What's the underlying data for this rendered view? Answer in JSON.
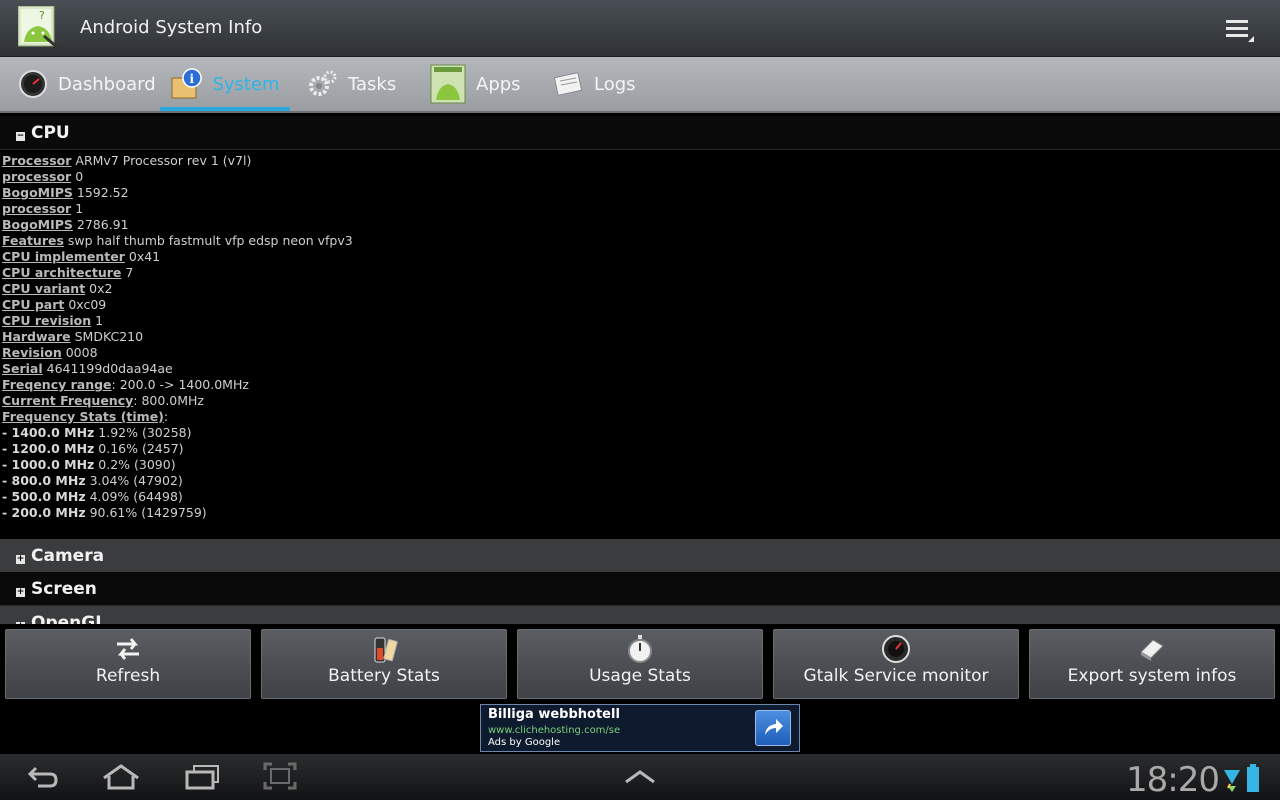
{
  "app": {
    "title": "Android System Info",
    "icon": "android-app-icon",
    "menu_icon": "overflow-menu-icon"
  },
  "tabs": [
    {
      "label": "Dashboard",
      "icon": "dashboard-gauge-icon",
      "active": false
    },
    {
      "label": "System",
      "icon": "system-info-icon",
      "active": true
    },
    {
      "label": "Tasks",
      "icon": "gears-icon",
      "active": false
    },
    {
      "label": "Apps",
      "icon": "android-apps-icon",
      "active": false
    },
    {
      "label": "Logs",
      "icon": "logs-icon",
      "active": false
    }
  ],
  "sections": [
    {
      "title": "CPU",
      "toggle": "−",
      "expanded": true
    },
    {
      "title": "Camera",
      "toggle": "+",
      "expanded": false
    },
    {
      "title": "Screen",
      "toggle": "+",
      "expanded": false
    },
    {
      "title": "OpenGL",
      "toggle": "+",
      "expanded": false
    }
  ],
  "cpu_info": [
    {
      "key": "Processor",
      "value": " ARMv7 Processor rev 1 (v7l)"
    },
    {
      "key": "processor",
      "value": " 0"
    },
    {
      "key": "BogoMIPS",
      "value": " 1592.52"
    },
    {
      "key": "processor",
      "value": " 1"
    },
    {
      "key": "BogoMIPS",
      "value": " 2786.91"
    },
    {
      "key": "Features",
      "value": " swp half thumb fastmult vfp edsp neon vfpv3"
    },
    {
      "key": "CPU implementer",
      "value": " 0x41"
    },
    {
      "key": "CPU architecture",
      "value": " 7"
    },
    {
      "key": "CPU variant",
      "value": " 0x2"
    },
    {
      "key": "CPU part",
      "value": " 0xc09"
    },
    {
      "key": "CPU revision",
      "value": " 1"
    },
    {
      "key": "Hardware",
      "value": " SMDKC210"
    },
    {
      "key": "Revision",
      "value": " 0008"
    },
    {
      "key": "Serial",
      "value": " 4641199d0daa94ae"
    },
    {
      "key": "Freqency range",
      "value": ": 200.0 -> 1400.0MHz"
    },
    {
      "key": "Current Frequency",
      "value": ": 800.0MHz"
    },
    {
      "key": "Frequency Stats (time)",
      "value": ":"
    }
  ],
  "freq_stats": [
    {
      "key": "- 1400.0 MHz",
      "value": " 1.92% (30258)"
    },
    {
      "key": "- 1200.0 MHz",
      "value": " 0.16% (2457)"
    },
    {
      "key": "- 1000.0 MHz",
      "value": " 0.2% (3090)"
    },
    {
      "key": "- 800.0 MHz",
      "value": " 3.04% (47902)"
    },
    {
      "key": "- 500.0 MHz",
      "value": " 4.09% (64498)"
    },
    {
      "key": "- 200.0 MHz",
      "value": " 90.61% (1429759)"
    }
  ],
  "buttons": [
    {
      "label": "Refresh",
      "icon": "refresh-arrows-icon"
    },
    {
      "label": "Battery Stats",
      "icon": "battery-icon"
    },
    {
      "label": "Usage Stats",
      "icon": "stopwatch-icon"
    },
    {
      "label": "Gtalk Service monitor",
      "icon": "gauge-icon"
    },
    {
      "label": "Export system infos",
      "icon": "export-icon"
    }
  ],
  "ad": {
    "title": "Billiga webbhotell",
    "url": "www.clichehosting.com/se",
    "by": "Ads by Google",
    "icon": "share-arrow-icon"
  },
  "system_bar": {
    "time": "18:20",
    "nav_icons": [
      "back-icon",
      "home-icon",
      "recent-apps-icon",
      "screenshot-icon",
      "menu-up-icon"
    ],
    "status_icons": [
      "wifi-icon",
      "battery-status-icon"
    ]
  }
}
